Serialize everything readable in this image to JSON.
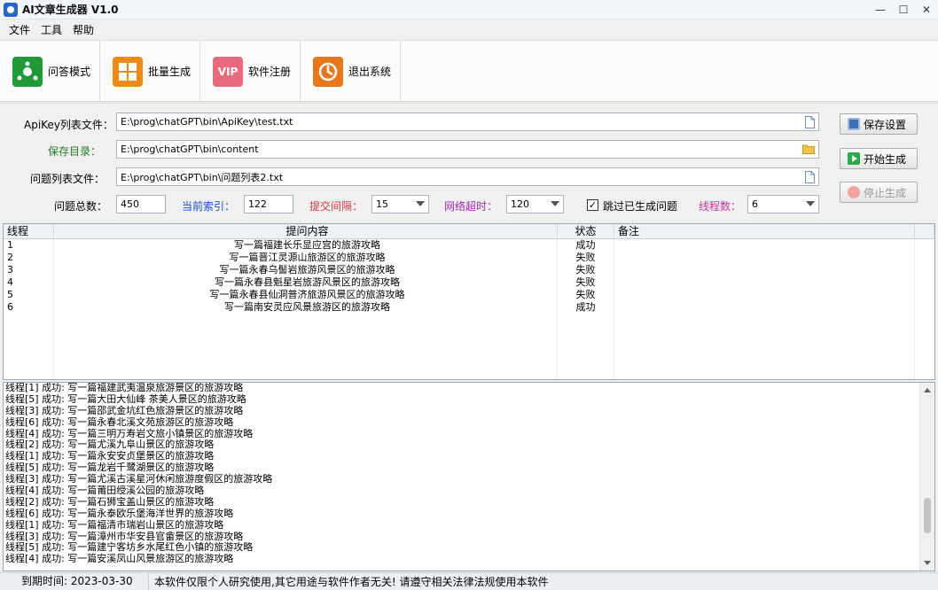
{
  "window": {
    "title": "AI文章生成器 V1.0"
  },
  "menu": [
    "文件",
    "工具",
    "帮助"
  ],
  "toolbar": [
    {
      "label": "问答模式",
      "icon": "chat-nodes-icon",
      "color": "#1f9a36"
    },
    {
      "label": "批量生成",
      "icon": "grid-batch-icon",
      "color": "#f08a12"
    },
    {
      "label": "软件注册",
      "icon": "vip-icon",
      "color": "#e96a7c"
    },
    {
      "label": "退出系统",
      "icon": "exit-icon",
      "color": "#e8761a"
    }
  ],
  "config": {
    "apikey_label": "ApiKey列表文件：",
    "apikey_value": "E:\\prog\\chatGPT\\bin\\ApiKey\\test.txt",
    "save_dir_label": "保存目录：",
    "save_dir_value": "E:\\prog\\chatGPT\\bin\\content",
    "question_file_label": "问题列表文件：",
    "question_file_value": "E:\\prog\\chatGPT\\bin\\问题列表2.txt",
    "total_label": "问题总数：",
    "total_value": "450",
    "index_label": "当前索引：",
    "index_value": "122",
    "interval_label": "提交间隔：",
    "interval_value": "15",
    "timeout_label": "网络超时：",
    "timeout_value": "120",
    "skip_label": "跳过已生成问题",
    "skip_checked": true,
    "threads_label": "线程数：",
    "threads_value": "6"
  },
  "buttons": {
    "save": "保存设置",
    "start": "开始生成",
    "stop": "停止生成"
  },
  "grid": {
    "headers": [
      "线程",
      "提问内容",
      "状态",
      "备注"
    ],
    "rows": [
      {
        "id": "1",
        "content": "写一篇福建长乐显应宫的旅游攻略",
        "status": "成功",
        "note": ""
      },
      {
        "id": "2",
        "content": "写一篇晋江灵源山旅游区的旅游攻略",
        "status": "失败",
        "note": ""
      },
      {
        "id": "3",
        "content": "写一篇永春乌髻岩旅游风景区的旅游攻略",
        "status": "失败",
        "note": ""
      },
      {
        "id": "4",
        "content": "写一篇永春县魁星岩旅游风景区的旅游攻略",
        "status": "失败",
        "note": ""
      },
      {
        "id": "5",
        "content": "写一篇永春县仙洞普济旅游风景区的旅游攻略",
        "status": "失败",
        "note": ""
      },
      {
        "id": "6",
        "content": "写一篇南安灵应风景旅游区的旅游攻略",
        "status": "成功",
        "note": ""
      }
    ]
  },
  "log": [
    "线程[1] 成功: 写一篇福建武夷温泉旅游景区的旅游攻略",
    "线程[5] 成功: 写一篇大田大仙峰 茶美人景区的旅游攻略",
    "线程[3] 成功: 写一篇邵武金坑红色旅游景区的旅游攻略",
    "线程[6] 成功: 写一篇永春北溪文苑旅游区的旅游攻略",
    "线程[4] 成功: 写一篇三明万寿岩文旅小镇景区的旅游攻略",
    "线程[2] 成功: 写一篇尤溪九阜山景区的旅游攻略",
    "线程[1] 成功: 写一篇永安安贞堡景区的旅游攻略",
    "线程[5] 成功: 写一篇龙岩千鹭湖景区的旅游攻略",
    "线程[3] 成功: 写一篇尤溪古溪星河休闲旅游度假区的旅游攻略",
    "线程[4] 成功: 写一篇莆田绶溪公园的旅游攻略",
    "线程[2] 成功: 写一篇石狮宝盖山景区的旅游攻略",
    "线程[6] 成功: 写一篇永泰欧乐堡海洋世界的旅游攻略",
    "线程[1] 成功: 写一篇福清市瑞岩山景区的旅游攻略",
    "线程[3] 成功: 写一篇漳州市华安县官畲景区的旅游攻略",
    "线程[5] 成功: 写一篇建宁客坊乡水尾红色小镇的旅游攻略",
    "线程[4] 成功: 写一篇安溪凤山风景旅游区的旅游攻略"
  ],
  "status": {
    "expiry": "到期时间: 2023-03-30",
    "notice": "本软件仅限个人研究使用,其它用途与软件作者无关! 请遵守相关法律法规使用本软件"
  }
}
